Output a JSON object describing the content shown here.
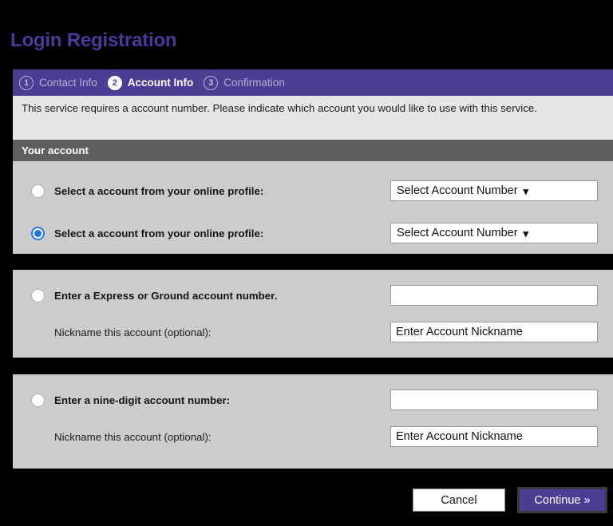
{
  "page": {
    "title": "Login Registration"
  },
  "stepper": {
    "steps": [
      {
        "number": "1",
        "label": "Contact Info",
        "state": "inactive"
      },
      {
        "number": "2",
        "label": "Account Info",
        "state": "active"
      },
      {
        "number": "3",
        "label": "Confirmation",
        "state": "inactive"
      }
    ]
  },
  "intro": {
    "text": "This service requires a account number. Please indicate which account you would like to use with this service."
  },
  "section": {
    "header": "Your account"
  },
  "profile_panel": {
    "rows": [
      {
        "label": "Select a account from your online profile:",
        "selected": false,
        "select_value": "Select Account Number",
        "chevron": "chevron-down-icon"
      },
      {
        "label": "Select a account from your online profile:",
        "selected": true,
        "select_value": "Select Account Number",
        "chevron": "chevron-down-icon"
      }
    ]
  },
  "express_panel": {
    "radio_label": "Enter a Express or Ground account number.",
    "selected": false,
    "account_value": "",
    "nickname_label": "Nickname this account (optional):",
    "nickname_value": "Enter Account Nickname"
  },
  "nine_digit_panel": {
    "radio_label": "Enter a nine-digit account number:",
    "selected": false,
    "account_value": "",
    "nickname_label": "Nickname this account (optional):",
    "nickname_value": "Enter Account Nickname"
  },
  "footer": {
    "cancel_label": "Cancel",
    "continue_label": "Continue »"
  },
  "colors": {
    "title_purple": "#4a3a9b",
    "stepper_purple": "#4d3c93",
    "section_gray": "#5f5f5f",
    "panel_gray": "#cccccc",
    "intro_gray": "#e6e6e6",
    "radio_blue": "#1a73e8",
    "background": "#000000"
  }
}
